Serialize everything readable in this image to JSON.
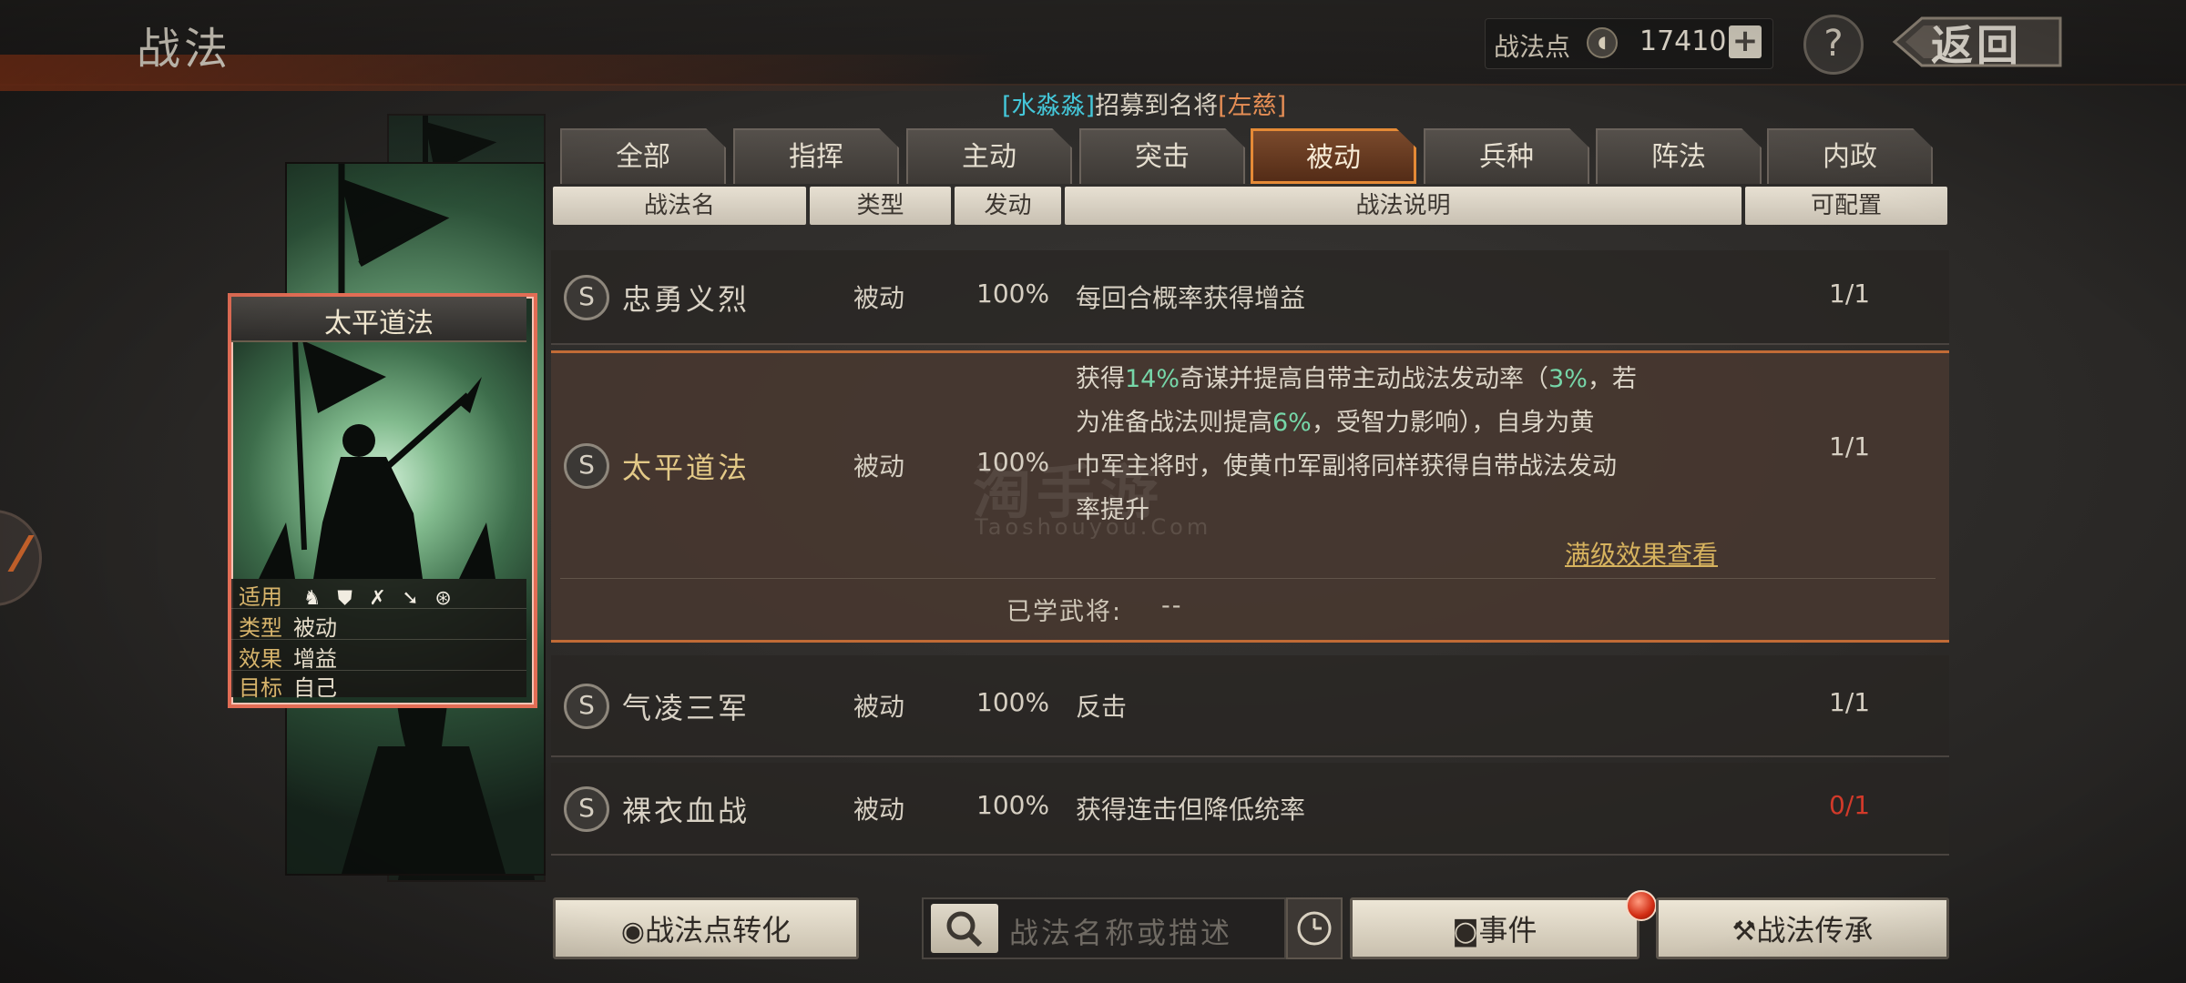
{
  "header": {
    "title": "战法",
    "points_label": "战法点",
    "points_value": "17410",
    "plus": "+",
    "help": "?",
    "back_label": "返回"
  },
  "announcement": {
    "bracket_l1": "[",
    "player": "水淼淼",
    "bracket_r1": "]",
    "middle": "招募到名将",
    "bracket_l2": "[",
    "general": "左慈",
    "bracket_r2": "]"
  },
  "card": {
    "title": "太平道法",
    "rows": [
      {
        "label": "适用",
        "value": ""
      },
      {
        "label": "类型",
        "value": "被动"
      },
      {
        "label": "效果",
        "value": "增益"
      },
      {
        "label": "目标",
        "value": "自己"
      }
    ],
    "unit_icons": [
      "cavalry-icon",
      "shield-icon",
      "bow-icon",
      "spear-icon",
      "wheel-icon"
    ]
  },
  "tabs": [
    "全部",
    "指挥",
    "主动",
    "突击",
    "被动",
    "兵种",
    "阵法",
    "内政"
  ],
  "active_tab": "被动",
  "columns": [
    "战法名",
    "类型",
    "发动",
    "战法说明",
    "可配置"
  ],
  "skills": [
    {
      "badge": "S",
      "name": "忠勇义烈",
      "type": "被动",
      "rate": "100%",
      "desc": "每回合概率获得增益",
      "config": "1/1"
    },
    {
      "badge": "S",
      "name": "太平道法",
      "type": "被动",
      "rate": "100%",
      "desc_parts": {
        "l1a": "获得",
        "l1b": "14%",
        "l1c": "奇谋并提高自带主动战法发动率（",
        "l1d": "3%",
        "l1e": "，若",
        "l2a": "为准备战法则提高",
        "l2b": "6%",
        "l2c": "，受智力影响），自身为黄",
        "l3": "巾军主将时，使黄巾军副将同样获得自带战法发动",
        "l4": "率提升"
      },
      "full_link": "满级效果查看",
      "learned_label": "已学武将:",
      "learned_value": "--",
      "config": "1/1"
    },
    {
      "badge": "S",
      "name": "气凌三军",
      "type": "被动",
      "rate": "100%",
      "desc": "反击",
      "config": "1/1"
    },
    {
      "badge": "S",
      "name": "裸衣血战",
      "type": "被动",
      "rate": "100%",
      "desc": "获得连击但降低统率",
      "config": "0/1"
    }
  ],
  "watermark": {
    "main": "淘手游",
    "sub": "Taoshouyou.Com"
  },
  "bottom": {
    "convert_label": "战法点转化",
    "search_placeholder": "战法名称或描述",
    "events_label": "事件",
    "inherit_label": "战法传承"
  },
  "colors": {
    "accent": "#e58a36",
    "highlight": "#76d6a8",
    "alert": "#d23a2a",
    "link": "#d6b25e"
  }
}
